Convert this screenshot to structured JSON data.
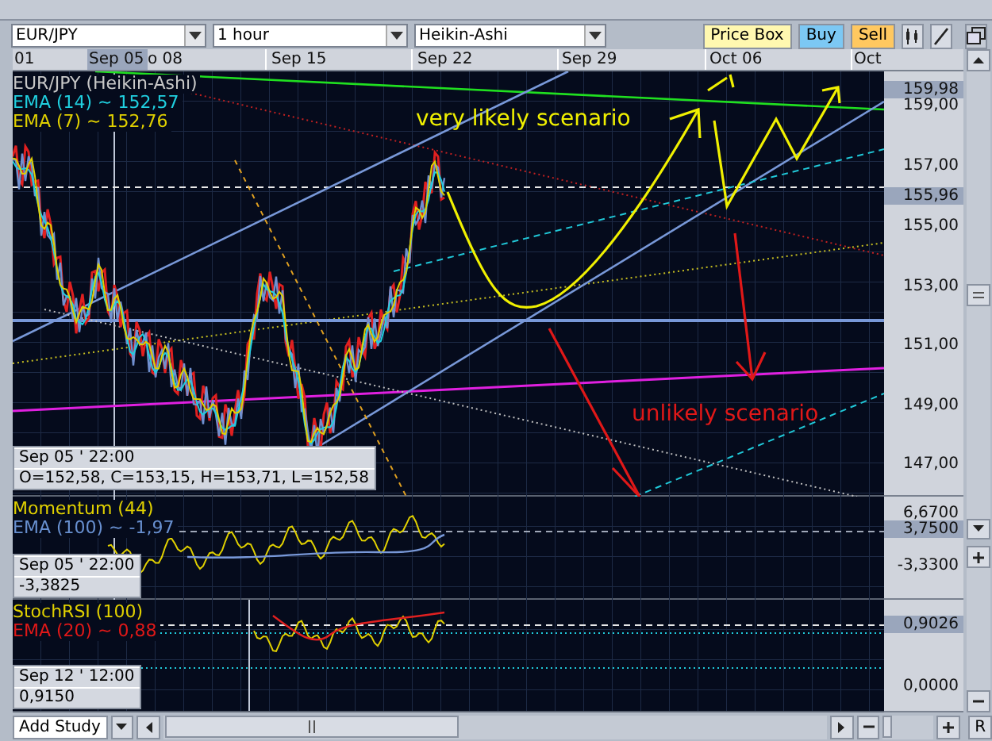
{
  "toolbar": {
    "symbol": "EUR/JPY",
    "interval": "1 hour",
    "chart_type": "Heikin-Ashi",
    "buttons": [
      {
        "label": "Price Box",
        "kind": "pricebox"
      },
      {
        "label": "Buy",
        "kind": "buy"
      },
      {
        "label": "Sell",
        "kind": "sell"
      }
    ]
  },
  "date_axis": [
    {
      "label": "01",
      "selected": false
    },
    {
      "label": "Sep 05",
      "selected": true
    },
    {
      "label": "o 08",
      "selected": false
    },
    {
      "label": "Sep 15",
      "selected": false
    },
    {
      "label": "Sep 22",
      "selected": false
    },
    {
      "label": "Sep 29",
      "selected": false
    },
    {
      "label": "Oct 06",
      "selected": false
    },
    {
      "label": "Oct",
      "selected": false
    }
  ],
  "main_panel": {
    "legend": [
      {
        "text": "EUR/JPY (Heikin-Ashi)",
        "color": "#c8c8c8"
      },
      {
        "text": "EMA (14) ~ 152,57",
        "color": "#20d0e0"
      },
      {
        "text": "EMA (7) ~ 152,76",
        "color": "#e0d000"
      }
    ],
    "annotations": [
      {
        "text": "very likely scenario",
        "color": "#f0f000"
      },
      {
        "text": "unlikely scenario",
        "color": "#e01818"
      }
    ],
    "info": {
      "time": "Sep 05 ' 22:00",
      "values": "O=152,58, C=153,15, H=153,71, L=152,58"
    },
    "price_labels": [
      {
        "text": "159,98",
        "highlighted": true
      },
      {
        "text": "159,00",
        "highlighted": false
      },
      {
        "text": "157,00",
        "highlighted": false
      },
      {
        "text": "155,96",
        "highlighted": true
      },
      {
        "text": "155,00",
        "highlighted": false
      },
      {
        "text": "153,00",
        "highlighted": false
      },
      {
        "text": "151,00",
        "highlighted": false
      },
      {
        "text": "149,00",
        "highlighted": false
      },
      {
        "text": "147,00",
        "highlighted": false
      }
    ]
  },
  "momentum_panel": {
    "legend": [
      {
        "text": "Momentum (44)",
        "color": "#e0d000"
      },
      {
        "text": "EMA (100) ~ -1,97",
        "color": "#6890d0"
      }
    ],
    "info": {
      "time": "Sep 05 ' 22:00",
      "values": "-3,3825"
    },
    "price_labels": [
      {
        "text": "6,6700",
        "highlighted": false
      },
      {
        "text": "3,7500",
        "highlighted": true
      },
      {
        "text": "-3,3300",
        "highlighted": false
      }
    ]
  },
  "stoch_panel": {
    "legend": [
      {
        "text": "StochRSI (100)",
        "color": "#e0d000"
      },
      {
        "text": "EMA (20) ~ 0,88",
        "color": "#e01818"
      }
    ],
    "info": {
      "time": "Sep 12 ' 12:00",
      "values": "0,9150"
    },
    "price_labels": [
      {
        "text": "0,9026",
        "highlighted": true
      },
      {
        "text": "0,0000",
        "highlighted": false
      }
    ]
  },
  "bottom_bar": {
    "study_button": "Add Study",
    "reset_button": "R"
  }
}
